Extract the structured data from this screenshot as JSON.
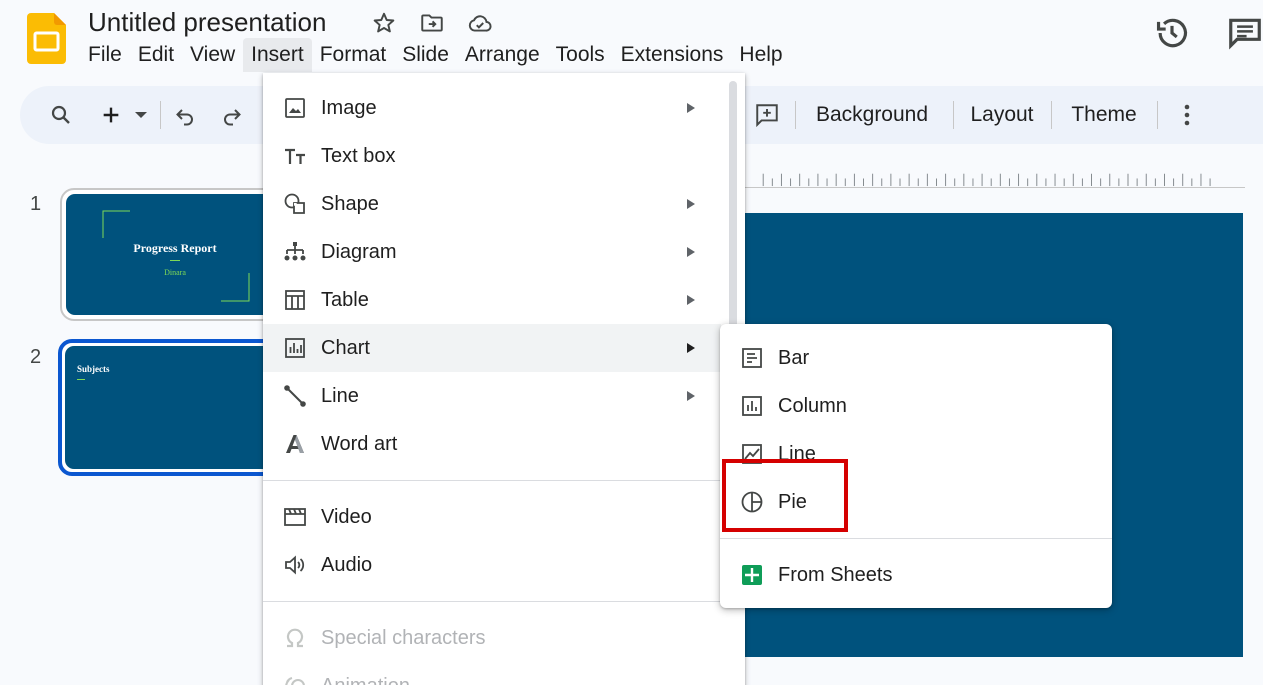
{
  "app": {
    "title": "Untitled presentation",
    "icons": [
      "slides-logo-icon",
      "star-icon",
      "move-folder-icon",
      "cloud-saved-icon",
      "version-history-icon",
      "comments-icon"
    ]
  },
  "menubar": [
    "File",
    "Edit",
    "View",
    "Insert",
    "Format",
    "Slide",
    "Arrange",
    "Tools",
    "Extensions",
    "Help"
  ],
  "menubar_active": "Insert",
  "toolbar": {
    "icons": [
      "search-icon",
      "new-slide-plus-icon",
      "new-slide-dropdown-icon",
      "undo-icon",
      "redo-icon",
      "add-comment-icon",
      "more-vert-icon"
    ],
    "background_label": "Background",
    "layout_label": "Layout",
    "theme_label": "Theme"
  },
  "slides": [
    {
      "number": "1",
      "title": "Progress Report",
      "subtitle": "Dinara"
    },
    {
      "number": "2",
      "title": "Subjects"
    }
  ],
  "insert_menu": {
    "items": [
      {
        "label": "Image",
        "icon": "image-icon",
        "submenu": true
      },
      {
        "label": "Text box",
        "icon": "text-box-icon",
        "submenu": false
      },
      {
        "label": "Shape",
        "icon": "shape-icon",
        "submenu": true
      },
      {
        "label": "Diagram",
        "icon": "diagram-icon",
        "submenu": true
      },
      {
        "label": "Table",
        "icon": "table-icon",
        "submenu": true
      },
      {
        "label": "Chart",
        "icon": "chart-icon",
        "submenu": true,
        "highlighted": true
      },
      {
        "label": "Line",
        "icon": "line-icon",
        "submenu": true
      },
      {
        "label": "Word art",
        "icon": "word-art-icon",
        "submenu": false
      },
      {
        "label": "Video",
        "icon": "video-icon",
        "submenu": false
      },
      {
        "label": "Audio",
        "icon": "audio-icon",
        "submenu": false
      },
      {
        "label": "Special characters",
        "icon": "omega-icon",
        "submenu": false,
        "disabled": true
      },
      {
        "label": "Animation",
        "icon": "animation-icon",
        "submenu": false,
        "disabled": true
      }
    ]
  },
  "chart_submenu": {
    "items": [
      {
        "label": "Bar",
        "icon": "bar-chart-icon"
      },
      {
        "label": "Column",
        "icon": "column-chart-icon"
      },
      {
        "label": "Line",
        "icon": "line-chart-icon"
      },
      {
        "label": "Pie",
        "icon": "pie-chart-icon",
        "marked": true
      },
      {
        "label": "From Sheets",
        "icon": "sheets-icon"
      }
    ]
  },
  "colors": {
    "slide_background": "#00527d",
    "highlight_box": "#d50000",
    "slides_logo": "#fbbc04",
    "sheets_logo": "#0f9d58",
    "selected_thumb_border": "#0b57d0"
  }
}
